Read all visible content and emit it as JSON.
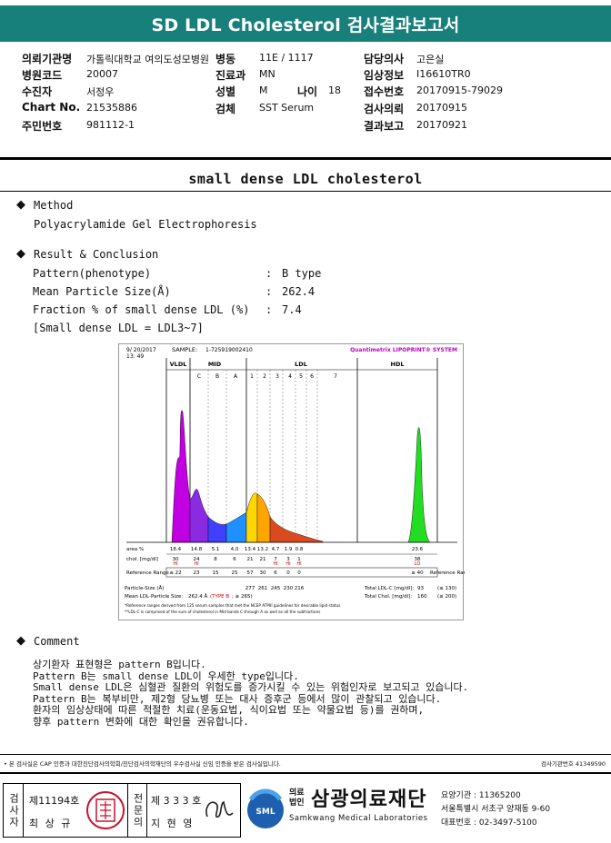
{
  "title": "SD LDL Cholesterol 검사결과보고서",
  "info": {
    "hospital_label": "의뢰기관명",
    "hospital_value": "가톨릭대학교 여의도성모병원",
    "ward_label": "병동",
    "ward_value": "11E / 1117",
    "doctor_label": "담당의사",
    "doctor_value": "고은실",
    "code_label": "병원코드",
    "code_value": "20007",
    "dept_label": "진료과",
    "dept_value": "MN",
    "clinical_label": "임상정보",
    "clinical_value": "I16610TR0",
    "patient_label": "수진자",
    "patient_value": "서정우",
    "sex_label": "성별",
    "sex_value": "M",
    "age_label": "나이",
    "age_value": "18",
    "receipt_label": "접수번호",
    "receipt_value": "20170915-79029",
    "chart_label": "Chart No.",
    "chart_value": "21535886",
    "specimen_label": "검체",
    "specimen_value": "SST Serum",
    "request_label": "검사의뢰",
    "request_value": "20170915",
    "id_label": "주민번호",
    "id_value": "981112-1",
    "report_label": "결과보고",
    "report_value": "20170921"
  },
  "section_title": "small dense LDL cholesterol",
  "method": {
    "heading": "Method",
    "text": "Polyacrylamide Gel Electrophoresis"
  },
  "result": {
    "heading": "Result & Conclusion",
    "rows": [
      {
        "label": "Pattern(phenotype)",
        "sep": ":",
        "value": "B type"
      },
      {
        "label": "Mean Particle Size(Å)",
        "sep": ":",
        "value": "262.4"
      },
      {
        "label": "Fraction % of small dense LDL (%)",
        "sep": ":",
        "value": "7.4"
      }
    ],
    "note": "[Small dense LDL = LDL3~7]"
  },
  "chart_data": {
    "type": "area",
    "header_left": "9/ 20/2017",
    "header_time": "13: 49",
    "sample_label": "SAMPLE:",
    "sample_value": "1-725919002410",
    "brand": "Quantimetrix LIPOPRINT® SYSTEM",
    "band_groups": [
      "VLDL",
      "MID",
      "LDL",
      "HDL"
    ],
    "bands": [
      "C",
      "B",
      "A",
      "1",
      "2",
      "3",
      "4",
      "5",
      "6",
      "7"
    ],
    "row_labels": {
      "area": "area %",
      "chol": "chol. [mg/dl]",
      "ref": "Reference Range",
      "ref_right": "Reference Range"
    },
    "area_pct": [
      "18.4",
      "14.8",
      "5.1",
      "4.0",
      "13.4",
      "13.2",
      "4.7",
      "1.9",
      "0.8",
      "23.6"
    ],
    "chol": [
      "30",
      "24",
      "8",
      "6",
      "21",
      "21",
      "7",
      "3",
      "1",
      "38"
    ],
    "chol_flags": [
      "HI",
      "HI",
      "",
      "",
      "",
      "",
      "HI",
      "HI",
      "HI",
      "LO"
    ],
    "ref_range": [
      "≤ 22",
      "23",
      "15",
      "25",
      "57",
      "30",
      "6",
      "0",
      "0",
      "≥ 40"
    ],
    "particle_size_label": "Particle-Size (Å)",
    "particle_sizes": [
      "277",
      "261",
      "245",
      "230",
      "216"
    ],
    "mean_size_label": "Mean LDL-Particle Size:",
    "mean_size_value": "262.4 Å",
    "mean_size_type": "(TYPE B",
    "mean_size_ref": "; ≥ 265)",
    "total_ldl_label": "Total LDL-C [mg/dl]:",
    "total_ldl_value": "93",
    "total_ldl_ref": "(≤ 130)",
    "total_chol_label": "Total Chol. [mg/dl]:",
    "total_chol_value": "160",
    "total_chol_ref": "(≤ 200)",
    "foot1": "*Reference ranges derived from 125 serum samples that met the NCEP ATPIII guidelines for desirable lipid status",
    "foot2": "**LDL-C is comprised of the sum of cholesterol in Mid bands C through A as well as all the subfractions",
    "colors": {
      "vldl": "#c000e0",
      "mid_c": "#8a2be2",
      "mid_b": "#4040ff",
      "mid_a": "#1e90ff",
      "ldl1": "#ffd700",
      "ldl2": "#ffa500",
      "ldl_rest": "#d94a1e",
      "hdl": "#22dd22"
    }
  },
  "comment": {
    "heading": "Comment",
    "lines": [
      "상기환자 표현형은 pattern B입니다.",
      "Pattern B는 small dense LDL이 우세한 type입니다.",
      "Small dense LDL은 심혈관 질환의 위험도를 증가시킬 수 있는 위험인자로 보고되고 있습니다.",
      "Pattern B는 복부비만, 제2형 당뇨병 또는 대사 증후군 등에서 많이 관찰되고 있습니다.",
      "환자의 임상상태에 따른 적절한 치료(운동요법, 식이요법 또는 약물요법 등)를 권하며,",
      "향후 pattern 변화에 대한 확인을 권유합니다."
    ]
  },
  "footer_note_left": "• 본 검사실은 CAP 인증과 대한진단검사의학회/진단검사의학재단의 우수검사실 신임 인증을 받은 검사실입니다.",
  "footer_note_right": "검사기관번호 41349590",
  "signatures": {
    "tester_title": "검사자",
    "tester_license": "제11194호",
    "tester_name": "최 상 규",
    "specialist_title": "전문의",
    "specialist_license": "제 3 3 3 호",
    "specialist_name": "지 현 영"
  },
  "org": {
    "prefix": "의료법인",
    "name": "삼광의료재단",
    "latin": "Samkwang Medical Laboratories",
    "logo_text": "SML",
    "agency_no": "요양기관 : 11365200",
    "address": "서울특별시 서초구 양재동 9-60",
    "phone": "대표번호 : 02-3497-5100"
  }
}
